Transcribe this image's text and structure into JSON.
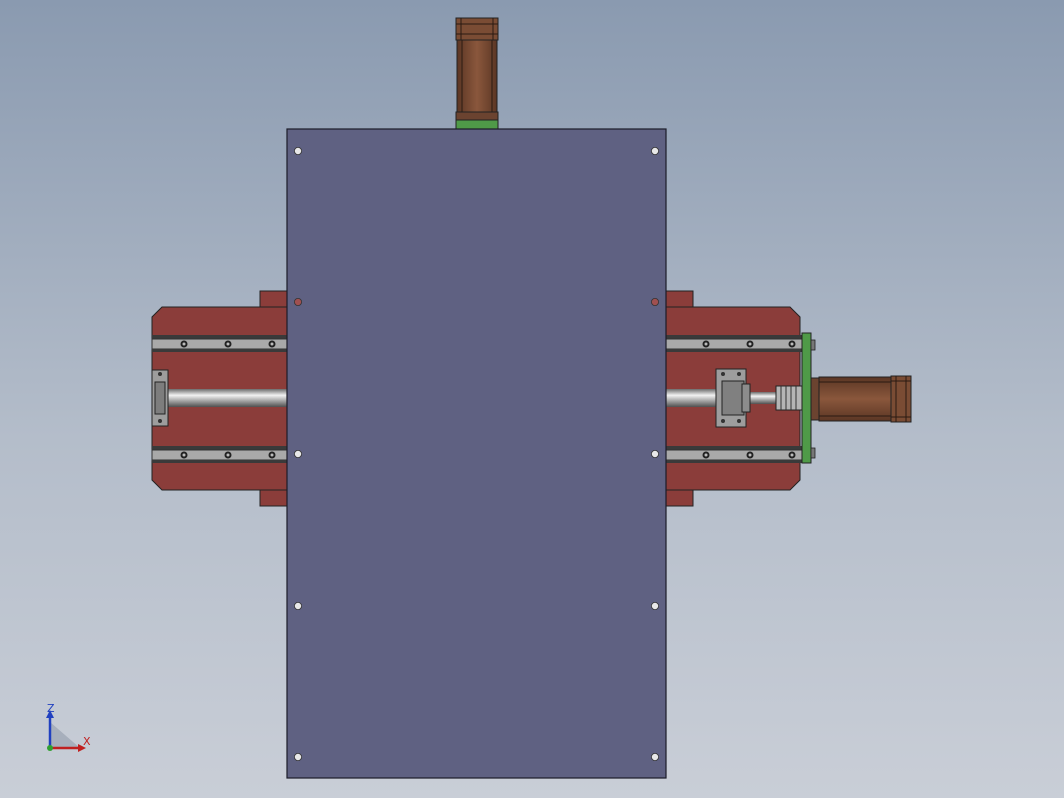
{
  "viewport": {
    "background_top": "#8a9ab0",
    "background_bottom": "#c9ced7"
  },
  "colors": {
    "plate": "#5f6182",
    "base": "#8b3d3a",
    "base_dark": "#6e2e2c",
    "rail": "#9a9a9a",
    "motor_body": "#7a4c34",
    "motor_flange": "#4f9a48"
  },
  "triad": {
    "z_label": "Z",
    "x_label": "X",
    "z_color": "#2040c0",
    "x_color": "#c02020"
  }
}
